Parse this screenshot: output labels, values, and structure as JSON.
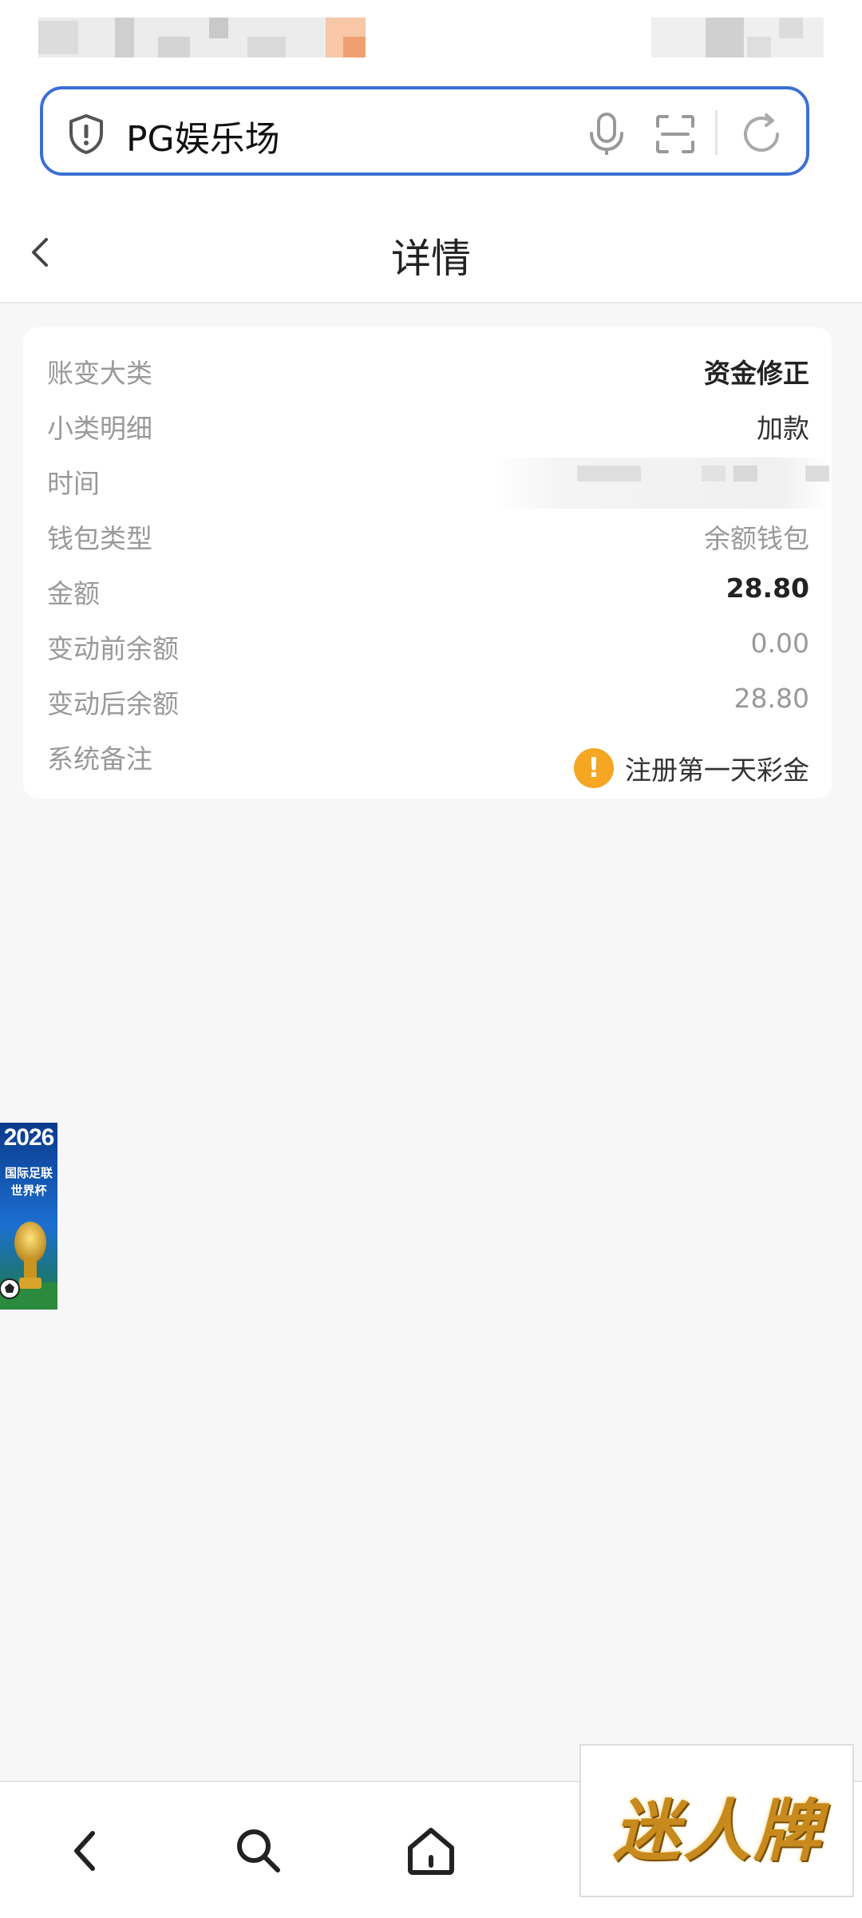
{
  "browser": {
    "address_text": "PG娱乐场",
    "icons": [
      "shield-icon",
      "microphone-icon",
      "scan-icon",
      "refresh-icon"
    ]
  },
  "header": {
    "title": "详情",
    "back_icon": "chevron-left-icon"
  },
  "details": {
    "rows": [
      {
        "label": "账变大类",
        "value": "资金修正"
      },
      {
        "label": "小类明细",
        "value": "加款"
      },
      {
        "label": "时间",
        "value": ""
      },
      {
        "label": "钱包类型",
        "value": "余额钱包"
      },
      {
        "label": "金额",
        "value": "28.80"
      },
      {
        "label": "变动前余额",
        "value": "0.00"
      },
      {
        "label": "变动后余额",
        "value": "28.80"
      },
      {
        "label": "系统备注",
        "value": "注册第一天彩金"
      }
    ],
    "note_icon": "warning-icon",
    "warn_color": "#f5a623"
  },
  "banner": {
    "year": "2026",
    "line1": "国际足联",
    "line2": "世界杯"
  },
  "bottom_nav": {
    "icons": [
      "back-icon",
      "search-icon",
      "home-icon"
    ]
  },
  "ad": {
    "text": "迷人牌"
  },
  "colors": {
    "accent": "#3b6fd4",
    "background": "#f7f7f7"
  }
}
